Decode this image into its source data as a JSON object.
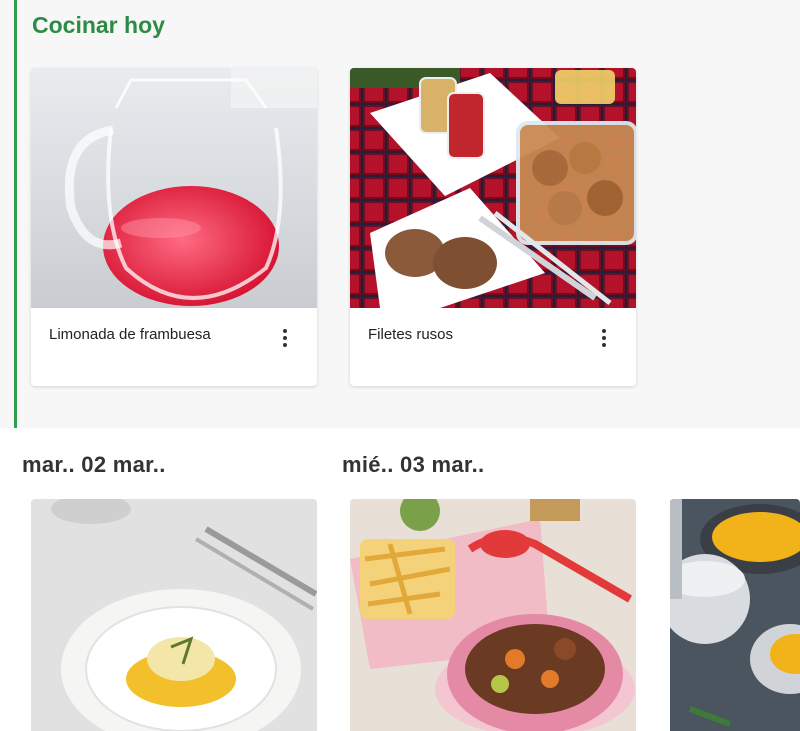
{
  "today": {
    "title": "Cocinar hoy",
    "recipes": [
      {
        "name": "Limonada de frambuesa",
        "image": "raspberry-lemonade-jug"
      },
      {
        "name": "Filetes rusos",
        "image": "meat-patties-picnic"
      }
    ]
  },
  "days": [
    {
      "label": "mar.. 02 mar..",
      "image": "plated-fish-yellow-sauce"
    },
    {
      "label": "mié.. 03 mar..",
      "image": "stew-and-fries"
    },
    {
      "label": "",
      "image": "pumpkin-soup-bowls"
    }
  ],
  "colors": {
    "accent": "#2e8b46",
    "accent_bar": "#2e9e4f"
  }
}
